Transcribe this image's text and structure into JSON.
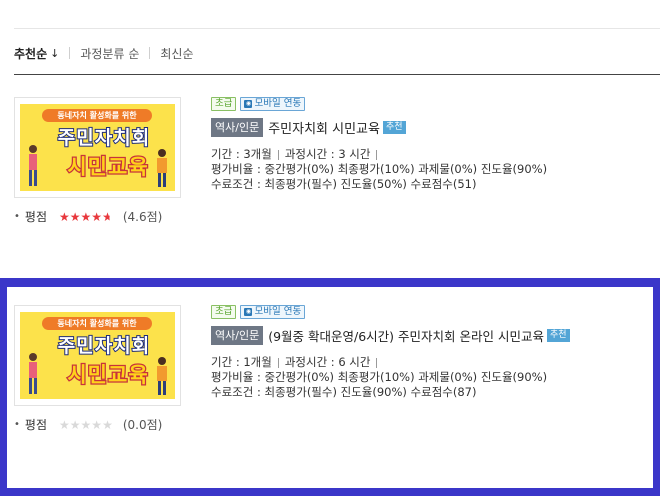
{
  "sort": {
    "options": [
      {
        "label": "추천순",
        "arrow": "↓",
        "active": true
      },
      {
        "label": "과정분류 순"
      },
      {
        "label": "최신순"
      }
    ]
  },
  "courses": [
    {
      "level_badge": "초급",
      "mobile_badge": "모바일 연동",
      "category": "역사/인문",
      "title": "주민자치회 시민교육",
      "recommend_badge": "추천",
      "period": "기간 : 3개월",
      "hours": "과정시간 : 3 시간",
      "weights": "평가비율 : 중간평가(0%) 최종평가(10%) 과제물(0%) 진도율(90%)",
      "completion": "수료조건 : 최종평가(필수) 진도율(50%) 수료점수(51)",
      "rating_label": "평점",
      "rating_value": 4.6,
      "rating_text": "(4.6점)",
      "thumb": {
        "subtitle": "동네자치 활성화를 위한",
        "line1": "주민자치회",
        "line2": "시민교육"
      }
    },
    {
      "level_badge": "초급",
      "mobile_badge": "모바일 연동",
      "category": "역사/인문",
      "title": "(9월중 확대운영/6시간) 주민자치회 온라인 시민교육",
      "recommend_badge": "추천",
      "period": "기간 : 1개월",
      "hours": "과정시간 : 6 시간",
      "weights": "평가비율 : 중간평가(0%) 최종평가(10%) 과제물(0%) 진도율(90%)",
      "completion": "수료조건 : 최종평가(필수) 진도율(90%) 수료점수(87)",
      "rating_label": "평점",
      "rating_value": 0.0,
      "rating_text": "(0.0점)",
      "thumb": {
        "subtitle": "동네자치 활성화를 위한",
        "line1": "주민자치회",
        "line2": "시민교육"
      }
    }
  ],
  "colors": {
    "highlight_border": "#3b36c9",
    "star_on": "#e8383d",
    "star_off": "#d9d9d9",
    "thumb_bg": "#fce24b"
  }
}
